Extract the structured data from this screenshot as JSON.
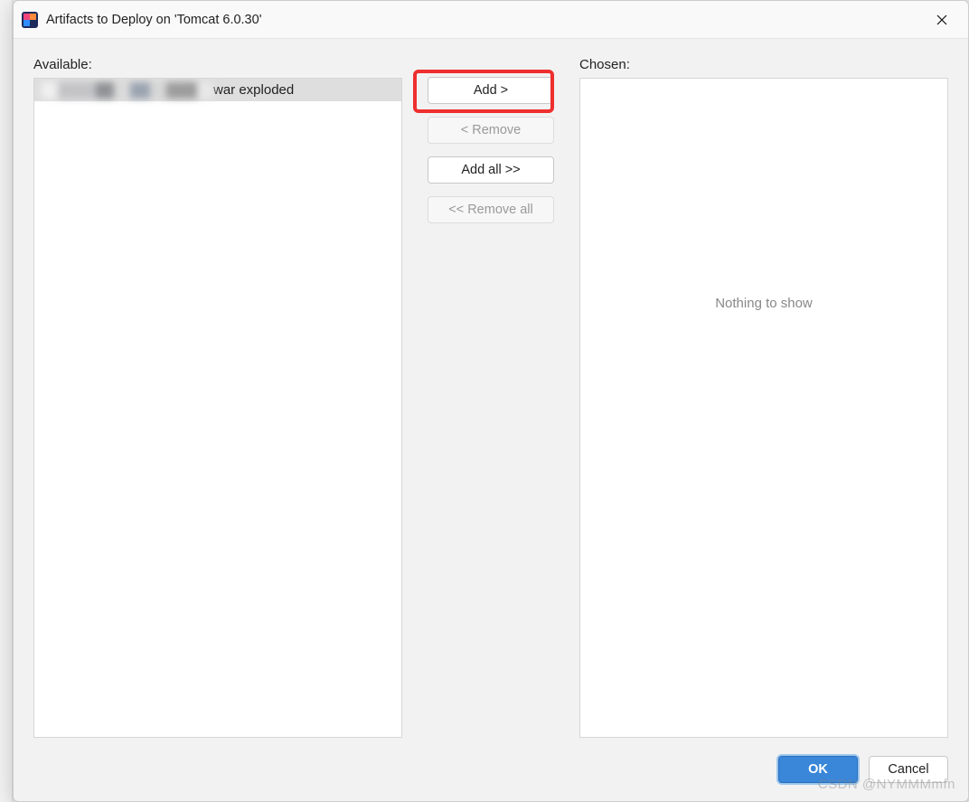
{
  "titlebar": {
    "title": "Artifacts to Deploy on 'Tomcat 6.0.30'"
  },
  "labels": {
    "available": "Available:",
    "chosen": "Chosen:"
  },
  "available_items": [
    {
      "text": "war exploded"
    }
  ],
  "chosen_empty_text": "Nothing to show",
  "buttons": {
    "add": "Add >",
    "remove": "< Remove",
    "add_all": "Add all >>",
    "remove_all": "<< Remove all",
    "ok": "OK",
    "cancel": "Cancel"
  },
  "watermark": "CSDN @NYMMMmfn"
}
